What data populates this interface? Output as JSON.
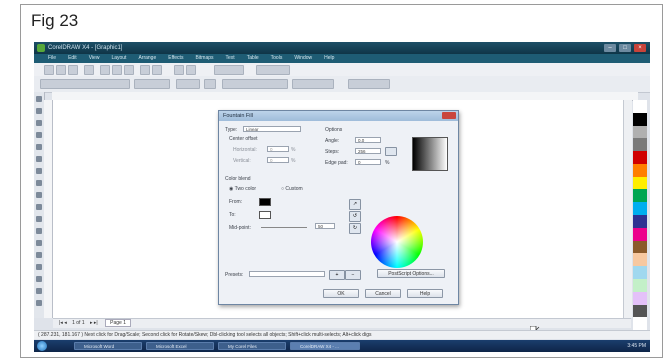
{
  "figure": {
    "caption": "Fig 23"
  },
  "window": {
    "title": "CorelDRAW X4 - [Graphic1]"
  },
  "menu": [
    "File",
    "Edit",
    "View",
    "Layout",
    "Arrange",
    "Effects",
    "Bitmaps",
    "Text",
    "Table",
    "Tools",
    "Window",
    "Help"
  ],
  "dialog": {
    "title": "Fountain Fill",
    "type_label": "Type:",
    "type_value": "Linear",
    "center_offset_label": "Center offset",
    "horizontal_label": "Horizontal:",
    "horizontal_value": "0",
    "vertical_label": "Vertical:",
    "vertical_value": "0",
    "options_label": "Options",
    "angle_label": "Angle:",
    "angle_value": "0.0",
    "steps_label": "Steps:",
    "steps_value": "256",
    "edge_pad_label": "Edge pad:",
    "edge_pad_value": "0",
    "edge_pad_unit": "%",
    "color_blend_label": "Color blend",
    "two_color_label": "Two color",
    "custom_label": "Custom",
    "from_label": "From:",
    "to_label": "To:",
    "mid_point_label": "Mid-point:",
    "mid_point_value": "50",
    "presets_label": "Presets:",
    "postscript_options_label": "PostScript Options...",
    "ok_label": "OK",
    "cancel_label": "Cancel",
    "help_label": "Help",
    "from_color": "#000000",
    "to_color": "#ffffff"
  },
  "pagebar": {
    "page_counter": "1 of 1",
    "page_tab": "Page 1"
  },
  "statusbar": {
    "text": "( 287.231, 181.167 )    Next click for Drag/Scale; Second click for Rotate/Skew; Dbl-clicking tool selects all objects; Shift+click multi-selects; Alt+click digs"
  },
  "taskbar": {
    "items": [
      "Microsoft Word",
      "Microsoft Excel",
      "My Corel Files",
      "CorelDRAW X4 - ..."
    ],
    "clock": "3:45 PM"
  },
  "palette_colors": [
    "#ffffff",
    "#000000",
    "#b0b0b0",
    "#7a7a7a",
    "#d00000",
    "#ff7f00",
    "#ffee00",
    "#00a651",
    "#00aeef",
    "#2e3192",
    "#ec008c",
    "#8b5a2b",
    "#f7c8a0",
    "#a0d8ef",
    "#c3f0c8",
    "#e4c1f9",
    "#555555",
    "#ffffff"
  ]
}
